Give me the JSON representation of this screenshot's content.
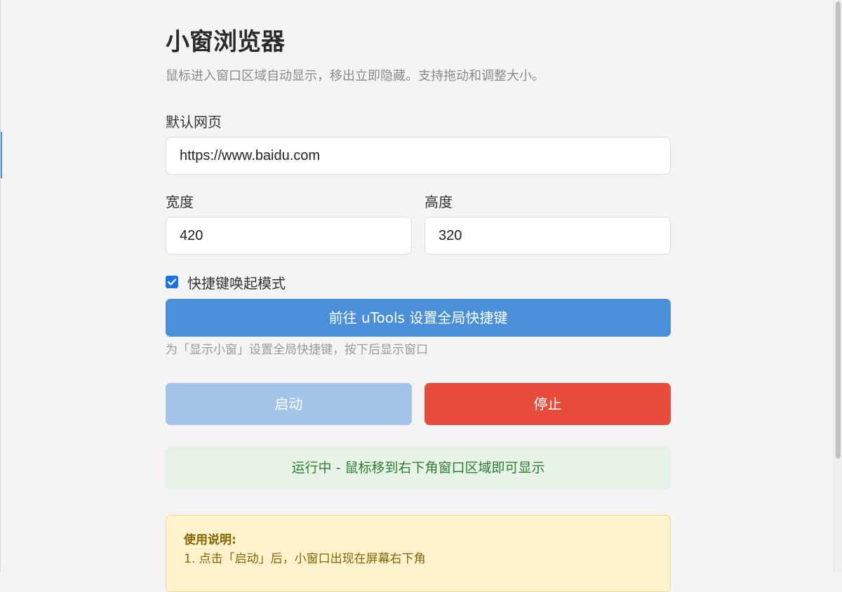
{
  "page": {
    "title": "小窗浏览器",
    "subtitle": "鼠标进入窗口区域自动显示，移出立即隐藏。支持拖动和调整大小。"
  },
  "form": {
    "url_label": "默认网页",
    "url_value": "https://www.baidu.com",
    "width_label": "宽度",
    "width_value": "420",
    "height_label": "高度",
    "height_value": "320",
    "hotkey_mode_label": "快捷键唤起模式",
    "hotkey_mode_checked": true
  },
  "shortcut_button_label": "前往 uTools 设置全局快捷键",
  "shortcut_hint": "为「显示小窗」设置全局快捷键，按下后显示窗口",
  "actions": {
    "start_label": "启动",
    "stop_label": "停止"
  },
  "status_text": "运行中 - 鼠标移到右下角窗口区域即可显示",
  "help": {
    "title": "使用说明:",
    "items": [
      "1. 点击「启动」后，小窗口出现在屏幕右下角"
    ]
  },
  "colors": {
    "primary": "#4a90d9",
    "start_disabled": "#a3c3e8",
    "stop": "#e74c3c",
    "status_bg": "#e6f3e6",
    "status_text": "#2e7d32",
    "help_bg": "#fff3cd",
    "help_text": "#856404"
  }
}
